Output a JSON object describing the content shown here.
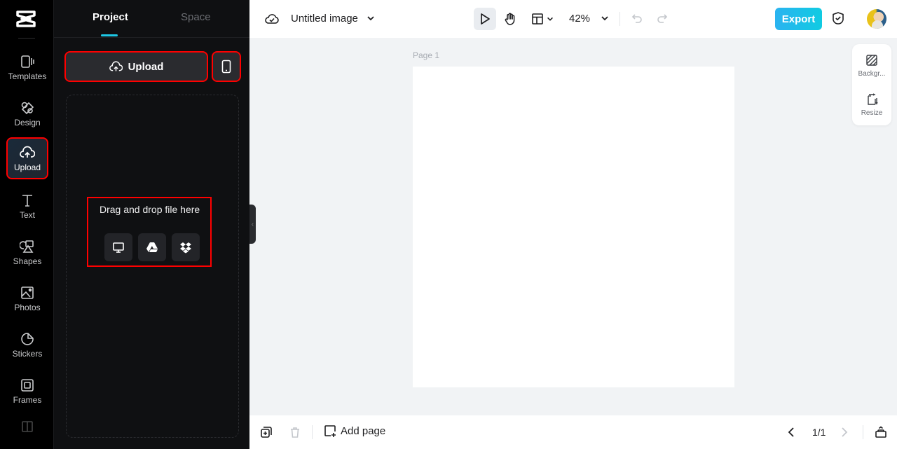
{
  "rail": {
    "items": [
      {
        "label": "Templates",
        "icon": "templates-icon"
      },
      {
        "label": "Design",
        "icon": "design-icon"
      },
      {
        "label": "Upload",
        "icon": "upload-cloud-icon",
        "active": true
      },
      {
        "label": "Text",
        "icon": "text-icon"
      },
      {
        "label": "Shapes",
        "icon": "shapes-icon"
      },
      {
        "label": "Photos",
        "icon": "photos-icon"
      },
      {
        "label": "Stickers",
        "icon": "stickers-icon"
      },
      {
        "label": "Frames",
        "icon": "frames-icon"
      }
    ]
  },
  "panel": {
    "tabs": [
      {
        "label": "Project",
        "active": true
      },
      {
        "label": "Space",
        "active": false
      }
    ],
    "upload_label": "Upload",
    "drop_text": "Drag and drop file here",
    "sources": [
      "computer-icon",
      "google-drive-icon",
      "dropbox-icon"
    ]
  },
  "topbar": {
    "title": "Untitled image",
    "zoom": "42%",
    "export_label": "Export"
  },
  "canvas": {
    "page_label": "Page 1"
  },
  "side_tools": [
    {
      "label": "Backgr..."
    },
    {
      "label": "Resize"
    }
  ],
  "bottombar": {
    "add_page_label": "Add page",
    "page_indicator": "1/1"
  },
  "colors": {
    "accent": "#1ec8e6",
    "export_start": "#2ab3f0",
    "export_end": "#10cbe2",
    "highlight": "#ff0000"
  }
}
